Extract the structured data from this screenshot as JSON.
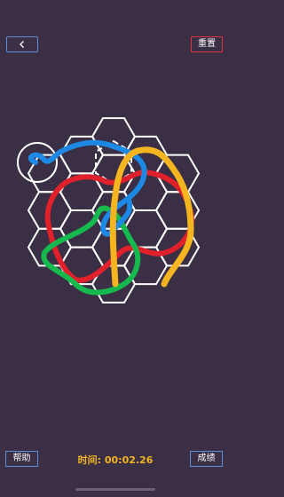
{
  "header": {
    "back_label": "<",
    "reset_label": "重置"
  },
  "footer": {
    "help_label": "帮助",
    "timer_label": "时间:",
    "timer_value": "00:02.26",
    "score_label": "成绩"
  },
  "colors": {
    "background": "#3a2f45",
    "grid_line": "#ffffff",
    "blue": "#1e88e5",
    "red": "#e0202a",
    "yellow": "#f5b521",
    "green": "#16b94e"
  },
  "board": {
    "cell_count": 19,
    "paths": [
      "blue",
      "red",
      "yellow",
      "green"
    ]
  }
}
